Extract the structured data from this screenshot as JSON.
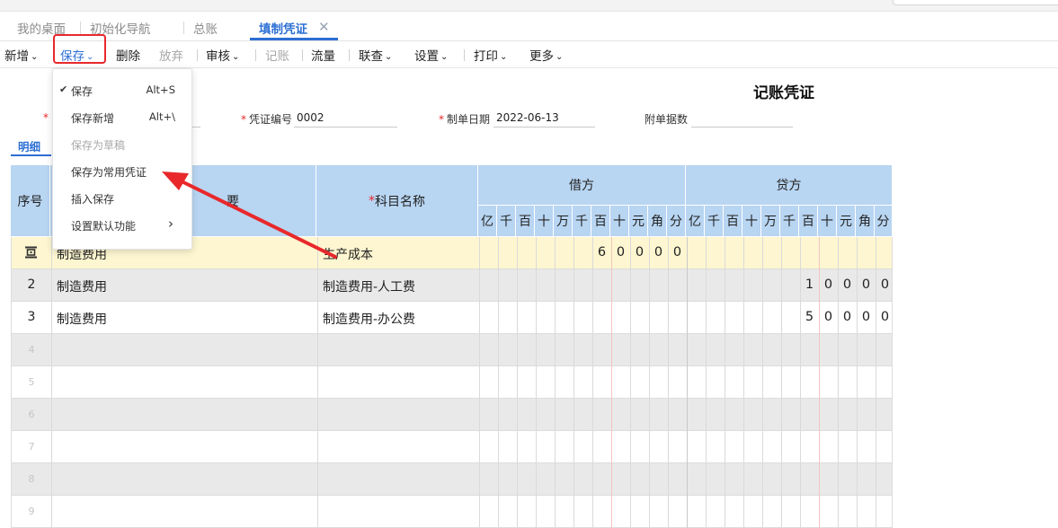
{
  "tabs": [
    {
      "label": "我的桌面"
    },
    {
      "label": "初始化导航"
    },
    {
      "label": "总账"
    },
    {
      "label": "填制凭证",
      "active": true,
      "close": "✕"
    }
  ],
  "toolbar": [
    {
      "label": "新增",
      "chevron": true
    },
    {
      "label": "保存",
      "chevron": true,
      "highlighted": true
    },
    {
      "label": "删除"
    },
    {
      "label": "放弃",
      "disabled": true
    },
    {
      "label": "审核",
      "chevron": true
    },
    {
      "label": "记账",
      "disabled": true
    },
    {
      "label": "流量"
    },
    {
      "label": "联查",
      "chevron": true
    },
    {
      "label": "设置",
      "chevron": true
    },
    {
      "label": "打印",
      "chevron": true
    },
    {
      "label": "更多",
      "chevron": true
    }
  ],
  "save_menu": {
    "items": [
      {
        "label": "保存",
        "shortcut": "Alt+S",
        "checked": true
      },
      {
        "label": "保存新增",
        "shortcut": "Alt+\\"
      },
      {
        "label": "保存为草稿",
        "disabled": true
      },
      {
        "label": "保存为常用凭证"
      },
      {
        "label": "插入保存"
      },
      {
        "label": "设置默认功能",
        "submenu": true
      }
    ]
  },
  "voucher": {
    "title": "记账凭证",
    "fields": {
      "voucher_no_label": "凭证编号",
      "voucher_no": "0002",
      "date_label": "制单日期",
      "date": "2022-06-13",
      "attach_label": "附单据数",
      "attach": ""
    },
    "detail_tab": "明细"
  },
  "table": {
    "headers": {
      "seq": "序号",
      "summary_tail": "要",
      "account": "科目名称",
      "debit": "借方",
      "credit": "贷方",
      "units": [
        "亿",
        "千",
        "百",
        "十",
        "万",
        "千",
        "百",
        "十",
        "元",
        "角",
        "分"
      ]
    },
    "rows": [
      {
        "seq": "",
        "summary": "制造费用",
        "account": "生产成本",
        "debit": "60000",
        "credit": "",
        "active": true
      },
      {
        "seq": "2",
        "summary": "制造费用",
        "account": "制造费用-人工费",
        "debit": "",
        "credit": "10000"
      },
      {
        "seq": "3",
        "summary": "制造费用",
        "account": "制造费用-办公费",
        "debit": "",
        "credit": "50000"
      },
      {
        "seq": "4",
        "summary": "",
        "account": "",
        "debit": "",
        "credit": ""
      },
      {
        "seq": "5",
        "summary": "",
        "account": "",
        "debit": "",
        "credit": ""
      },
      {
        "seq": "6",
        "summary": "",
        "account": "",
        "debit": "",
        "credit": ""
      },
      {
        "seq": "7",
        "summary": "",
        "account": "",
        "debit": "",
        "credit": ""
      },
      {
        "seq": "8",
        "summary": "",
        "account": "",
        "debit": "",
        "credit": ""
      },
      {
        "seq": "9",
        "summary": "",
        "account": "",
        "debit": "",
        "credit": ""
      }
    ]
  },
  "colors": {
    "accent": "#2d6fd4",
    "highlight": "#e8282b",
    "header_bg": "#b8d5f2",
    "active_row": "#fdf6d0",
    "alt_row": "#e9e9e9"
  },
  "icons": {
    "row_action": "row-action-icon",
    "check": "check-icon",
    "submenu": "chevron-right-icon",
    "dropdown": "chevron-down-icon",
    "close": "close-icon"
  }
}
